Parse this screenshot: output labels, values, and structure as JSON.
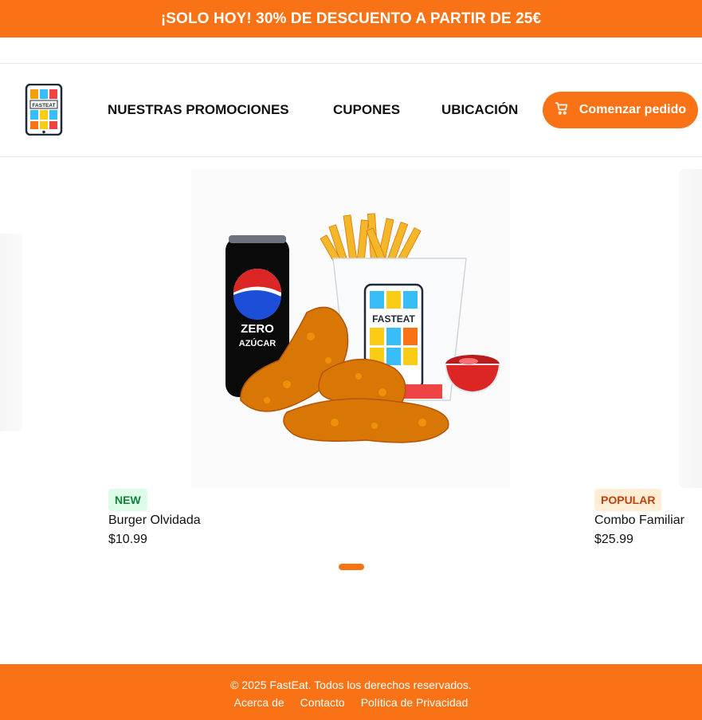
{
  "promo": {
    "text": "¡SOLO HOY! 30% DE DESCUENTO A PARTIR DE 25€"
  },
  "header": {
    "logo_text": "FASTEAT",
    "nav": {
      "promos": "NUESTRAS PROMOCIONES",
      "cupones": "CUPONES",
      "ubicacion": "UBICACIÓN"
    },
    "order_button": "Comenzar pedido"
  },
  "carousel": {
    "image": {
      "can_line1": "ZERO",
      "can_line2": "AZÚCAR",
      "box_text": "FASTEAT"
    },
    "cards": [
      {
        "badge": "NEW",
        "name": "Burger Olvidada",
        "price": "$10.99"
      },
      {
        "badge": "POPULAR",
        "name": "Combo Familiar",
        "price": "$25.99"
      }
    ]
  },
  "footer": {
    "copyright": "© 2025 FastEat. Todos los derechos reservados.",
    "links": [
      "Acerca de",
      "Contacto",
      "Política de Privacidad"
    ]
  },
  "colors": {
    "accent": "#f97316",
    "badge_new_bg": "#dcfce7",
    "badge_new_text": "#15803d",
    "badge_popular_bg": "#ffedd5",
    "badge_popular_text": "#c2410c"
  }
}
